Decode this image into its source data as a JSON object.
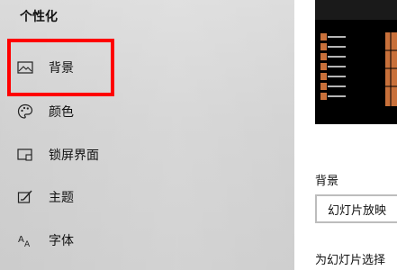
{
  "sidebar": {
    "title": "个性化",
    "items": [
      {
        "label": "背景",
        "icon": "picture-icon"
      },
      {
        "label": "颜色",
        "icon": "palette-icon"
      },
      {
        "label": "锁屏界面",
        "icon": "lock-screen-icon"
      },
      {
        "label": "主题",
        "icon": "theme-icon"
      },
      {
        "label": "字体",
        "icon": "font-icon"
      }
    ]
  },
  "main": {
    "background_label": "背景",
    "background_value": "幻灯片放映",
    "slideshow_hint": "为幻灯片选择"
  },
  "colors": {
    "highlight": "#ff0000",
    "preview_bg": "#000000",
    "preview_accent": "#c8703a"
  }
}
